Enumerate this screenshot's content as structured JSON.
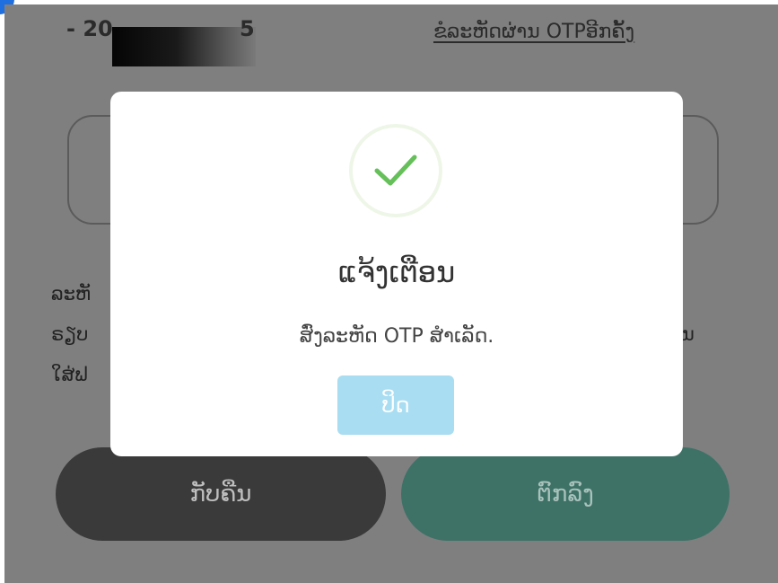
{
  "header": {
    "phone_prefix": "- 20",
    "phone_suffix": "5",
    "resend_otp_link": "ຂໍລະຫັດຜ່ານ OTPອີກຄັ້ງ"
  },
  "instructions": {
    "text": "ລະຫັ\nຣຽບ\nໃສ່ຟ",
    "line2_tail": "ນ"
  },
  "buttons": {
    "back": "ກັບຄືນ",
    "confirm": "ຕົກລົງ"
  },
  "modal": {
    "title": "ແຈ້ງເຕືອນ",
    "message": "ສົ່ງລະຫັດ OTP ສຳເລັດ.",
    "close_label": "ປິດ",
    "icon": "check-icon"
  },
  "colors": {
    "check": "#66c05a",
    "close_button": "#a9ddf1",
    "confirm_button": "#3e7267",
    "back_button": "#3a3a3a",
    "overlay": "#7f7f7f"
  }
}
